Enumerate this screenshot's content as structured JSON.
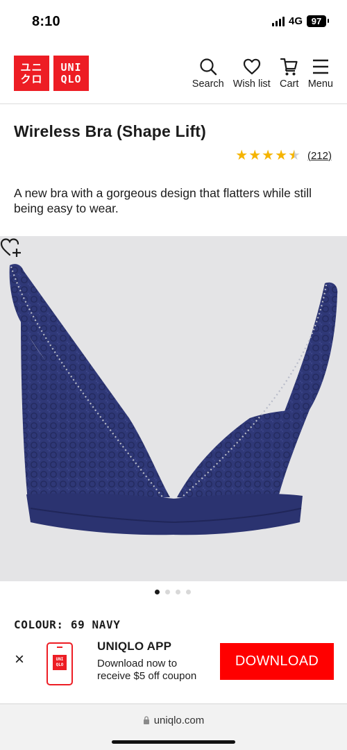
{
  "status_bar": {
    "time": "8:10",
    "network": "4G",
    "battery": "97"
  },
  "header": {
    "logo_left_lines": [
      "ユニ",
      "クロ"
    ],
    "logo_right_lines": [
      "UNI",
      "QLO"
    ],
    "nav": [
      {
        "label": "Search",
        "icon": "search-icon"
      },
      {
        "label": "Wish list",
        "icon": "heart-icon"
      },
      {
        "label": "Cart",
        "icon": "cart-icon"
      },
      {
        "label": "Menu",
        "icon": "menu-icon"
      }
    ]
  },
  "product": {
    "title": "Wireless Bra (Shape Lift)",
    "rating": 4.5,
    "review_count": "(212)",
    "description": "A new bra with a gorgeous design that flatters while still being easy to wear.",
    "image_subject": "navy lace wireless bra",
    "carousel": {
      "total": 4,
      "active": 1
    },
    "colour": "COLOUR: 69 NAVY"
  },
  "app_banner": {
    "title": "UNIQLO APP",
    "description": "Download now to receive $5 off coupon",
    "mini_logo_lines": [
      "UNI",
      "QLO"
    ],
    "button_label": "DOWNLOAD"
  },
  "browser": {
    "url": "uniqlo.com"
  },
  "colors": {
    "brand_red": "#ed1d24",
    "button_red": "#ff0000",
    "star": "#f5b400",
    "product_navy": "#2b3370",
    "image_bg": "#e4e4e6"
  }
}
